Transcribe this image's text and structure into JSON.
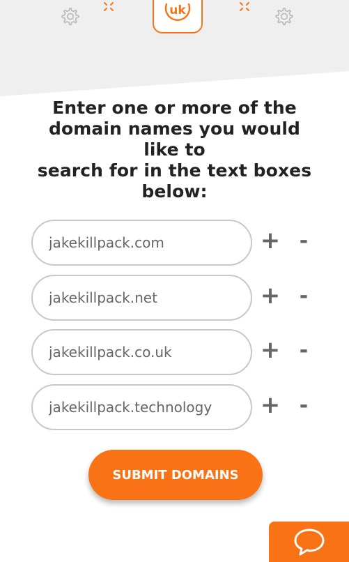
{
  "header": {
    "logo_text": "uk",
    "icons": [
      "gear-icon",
      "sparkle-icon",
      "sparkle-icon",
      "gear-icon"
    ]
  },
  "heading": {
    "lines": [
      "Enter one or more of the",
      "domain names you would",
      "like to",
      "search for in the text boxes",
      "below:"
    ]
  },
  "domains": [
    {
      "value": "jakekillpack.com",
      "add_label": "+",
      "remove_label": "-"
    },
    {
      "value": "jakekillpack.net",
      "add_label": "+",
      "remove_label": "-"
    },
    {
      "value": "jakekillpack.co.uk",
      "add_label": "+",
      "remove_label": "-"
    },
    {
      "value": "jakekillpack.technology",
      "add_label": "+",
      "remove_label": "-"
    }
  ],
  "submit": {
    "label": "SUBMIT DOMAINS"
  },
  "chat": {
    "icon": "chat-bubble-icon"
  },
  "colors": {
    "accent": "#f97316",
    "band": "#efefef",
    "text": "#222222",
    "input_border": "#c8c8c8",
    "icon_grey": "#666666"
  }
}
